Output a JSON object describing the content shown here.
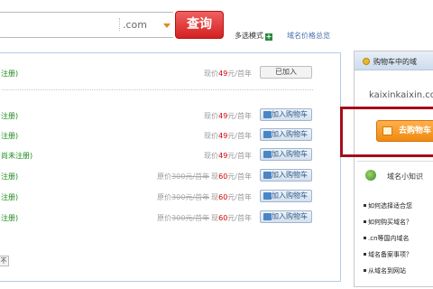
{
  "search": {
    "suffix": ".com",
    "button_label": "查询",
    "multi_mode_label": "多选模式",
    "price_overview_label": "域名价格总览"
  },
  "results": [
    {
      "name": "注册)",
      "price_label": "现价",
      "price": "49",
      "unit": "元/首年",
      "original": "",
      "button": "已加入",
      "added": true
    },
    {
      "name": "注册)",
      "price_label": "现价",
      "price": "49",
      "unit": "元/首年",
      "original": "",
      "button": "加入购物车",
      "added": false
    },
    {
      "name": "注册)",
      "price_label": "现价",
      "price": "49",
      "unit": "元/首年",
      "original": "",
      "button": "加入购物车",
      "added": false
    },
    {
      "name": "尚未注册)",
      "price_label": "现价",
      "price": "49",
      "unit": "元/首年",
      "original": "",
      "button": "加入购物车",
      "added": false
    },
    {
      "name": "注册)",
      "price_label": "原价",
      "price": "60",
      "unit": "元/首年",
      "original": "300元/首年",
      "now_label": "现",
      "button": "加入购物车",
      "added": false
    },
    {
      "name": "注册)",
      "price_label": "原价",
      "price": "60",
      "unit": "元/首年",
      "original": "300元/首年",
      "now_label": "现",
      "button": "加入购物车",
      "added": false
    },
    {
      "name": "注册)",
      "price_label": "原价",
      "price": "60",
      "unit": "元/首年",
      "original": "300元/首年",
      "now_label": "现",
      "button": "加入购物车",
      "added": false
    }
  ],
  "mini_button": "不",
  "cart": {
    "title": "购物车中的域",
    "domain": "kaixinkaixin.com",
    "checkout_label": "去购物车"
  },
  "knowledge": {
    "title": "域名小知识",
    "tips": [
      "如何选择适合您",
      "如何购买域名？",
      ".cn等国内域名",
      "域名备案事项？",
      "从域名到网站"
    ]
  },
  "colors": {
    "accent": "#d42020",
    "link": "#4a6ea8",
    "price": "#d40000",
    "frame": "#a40f1a",
    "checkout": "#f08a10"
  }
}
